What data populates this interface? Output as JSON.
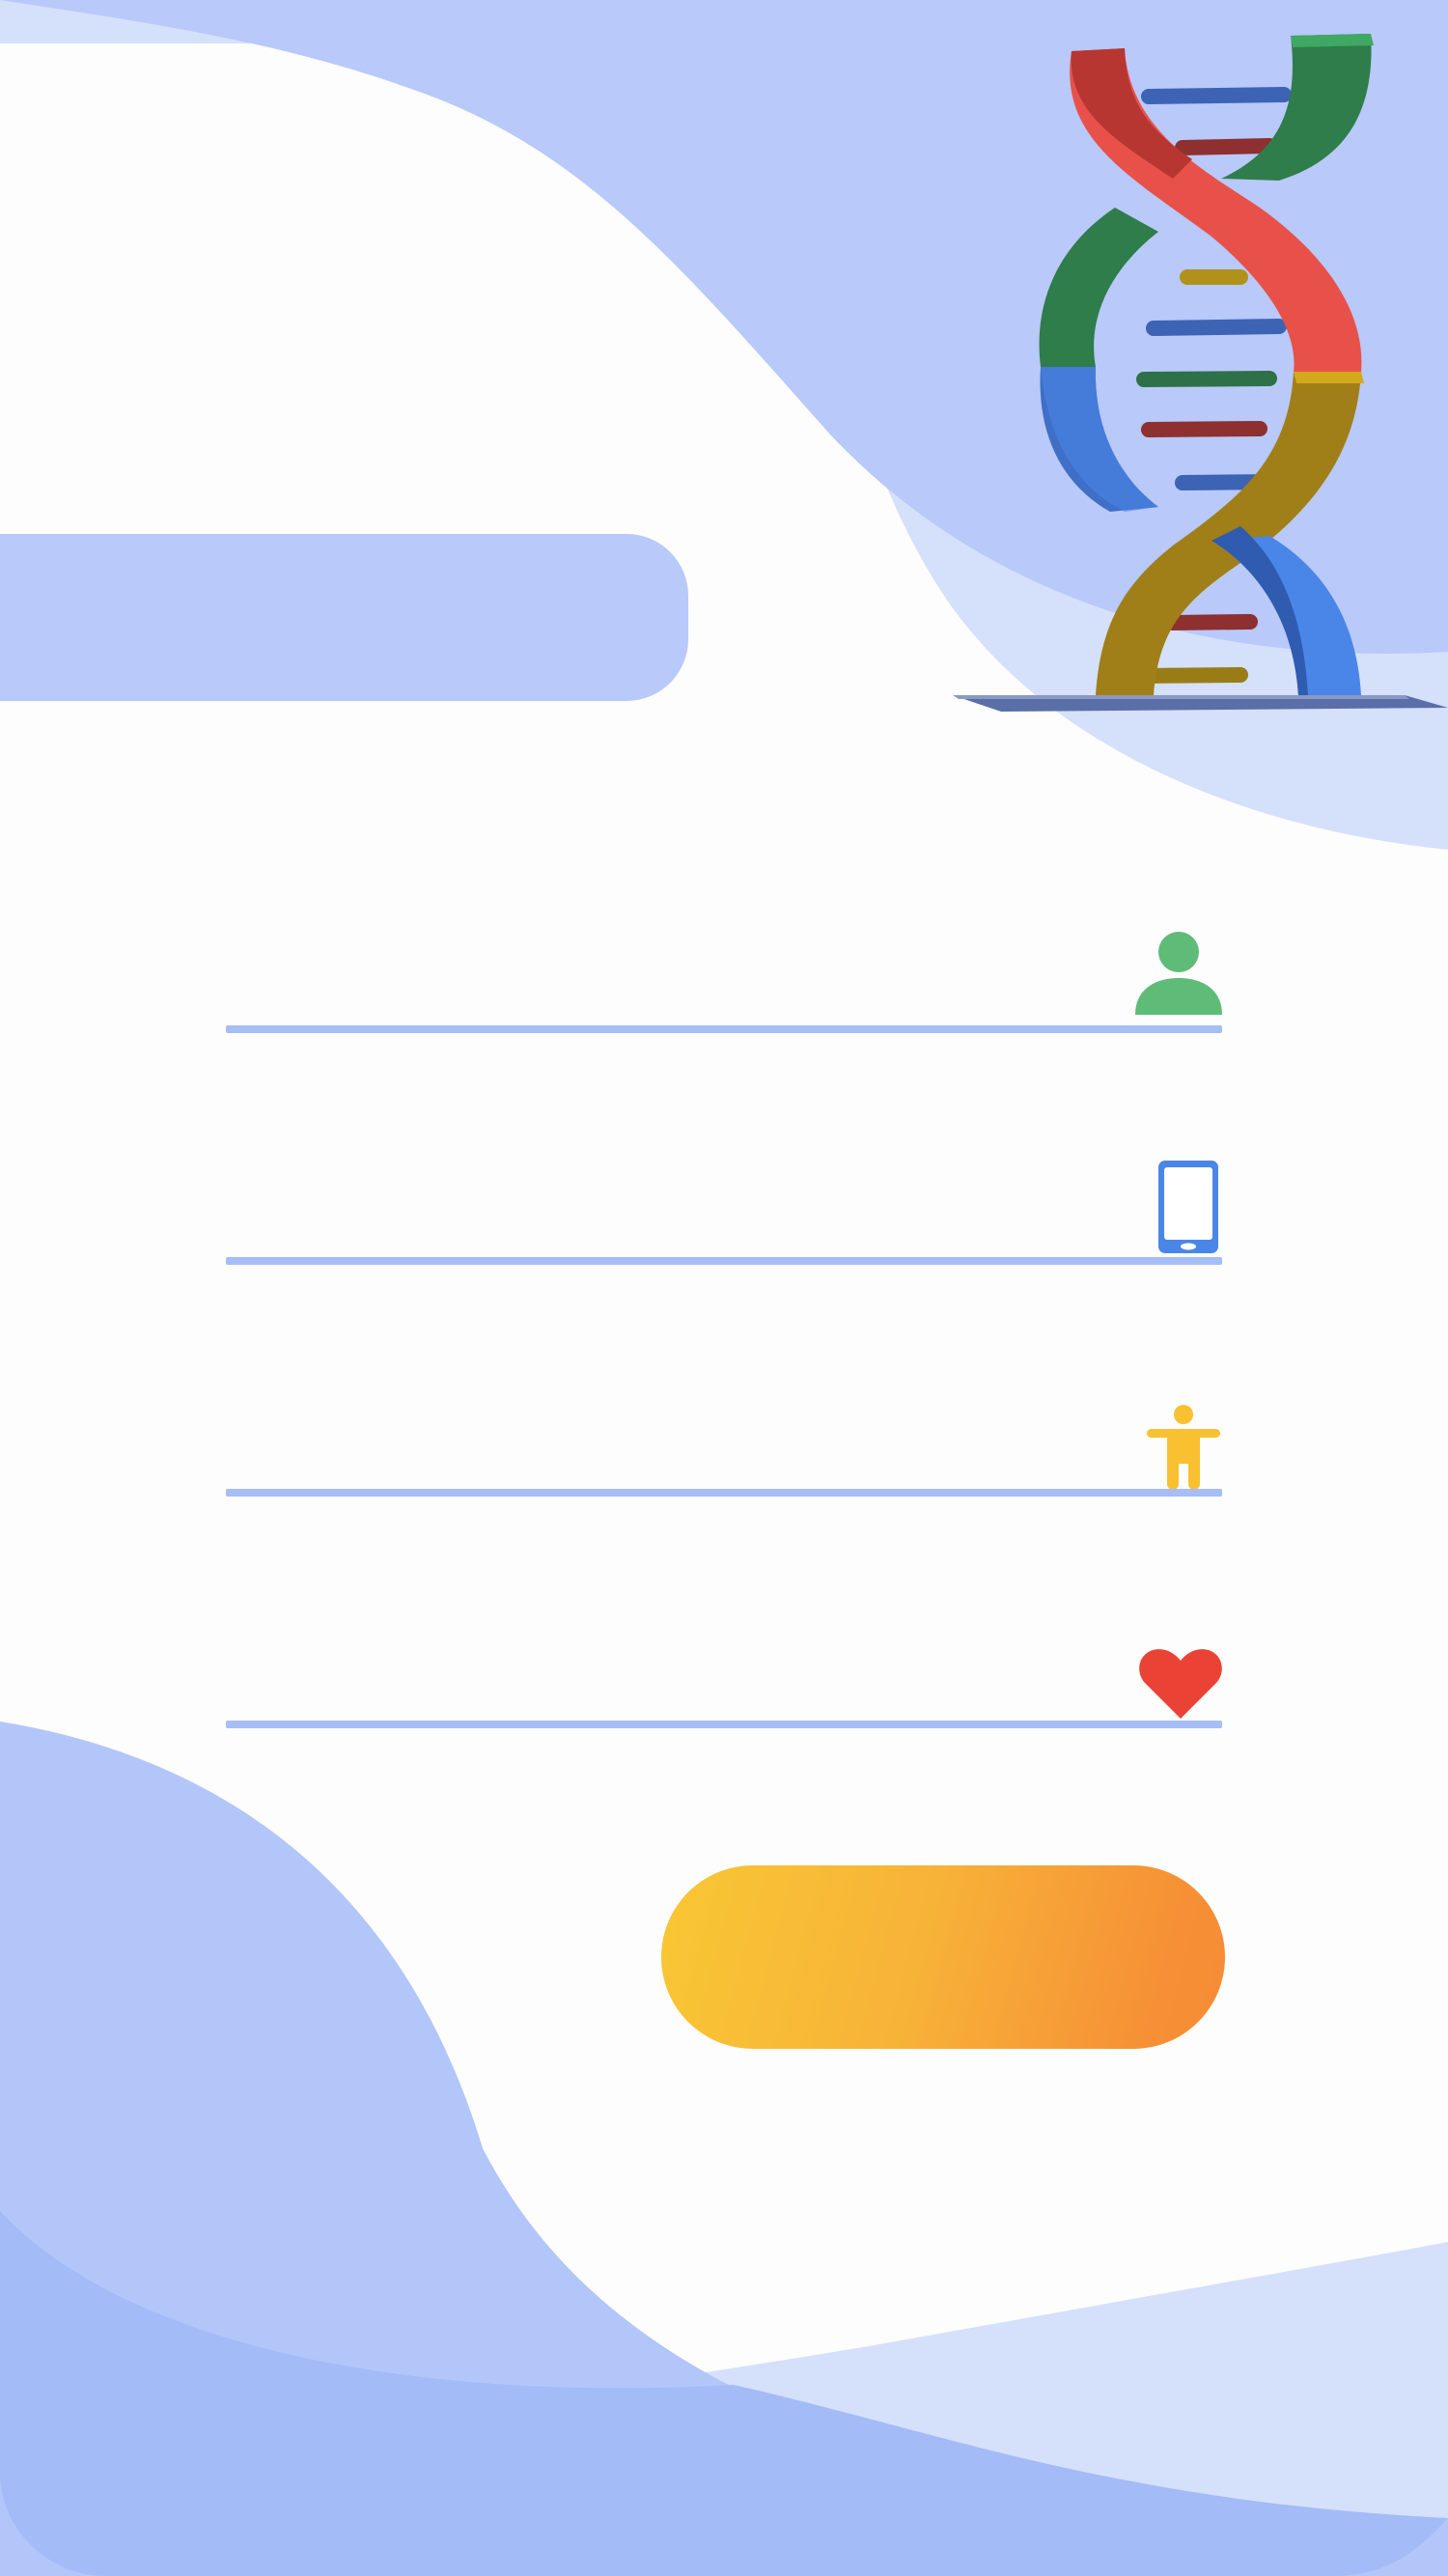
{
  "form": {
    "title": "",
    "fields": {
      "name": {
        "value": "",
        "placeholder": "",
        "icon": "person-icon"
      },
      "phone": {
        "value": "",
        "placeholder": "",
        "icon": "mobile-phone-icon"
      },
      "body": {
        "value": "",
        "placeholder": "",
        "icon": "accessibility-figure-icon"
      },
      "health": {
        "value": "",
        "placeholder": "",
        "icon": "heart-icon"
      }
    },
    "submit_label": ""
  },
  "illustration": {
    "icon": "dna-helix-icon"
  },
  "colors": {
    "background": "#fdfdfd",
    "blob_light": "#b8c9fa",
    "blob_lighter": "#d5e0fb",
    "blob_mid": "#a3bbf7",
    "underline": "#a6bdf5",
    "person_icon": "#5fbc78",
    "phone_icon": "#4a86e8",
    "figure_icon": "#f9c032",
    "heart_icon": "#ea4335",
    "button_start": "#f9c734",
    "button_end": "#f68c35"
  }
}
